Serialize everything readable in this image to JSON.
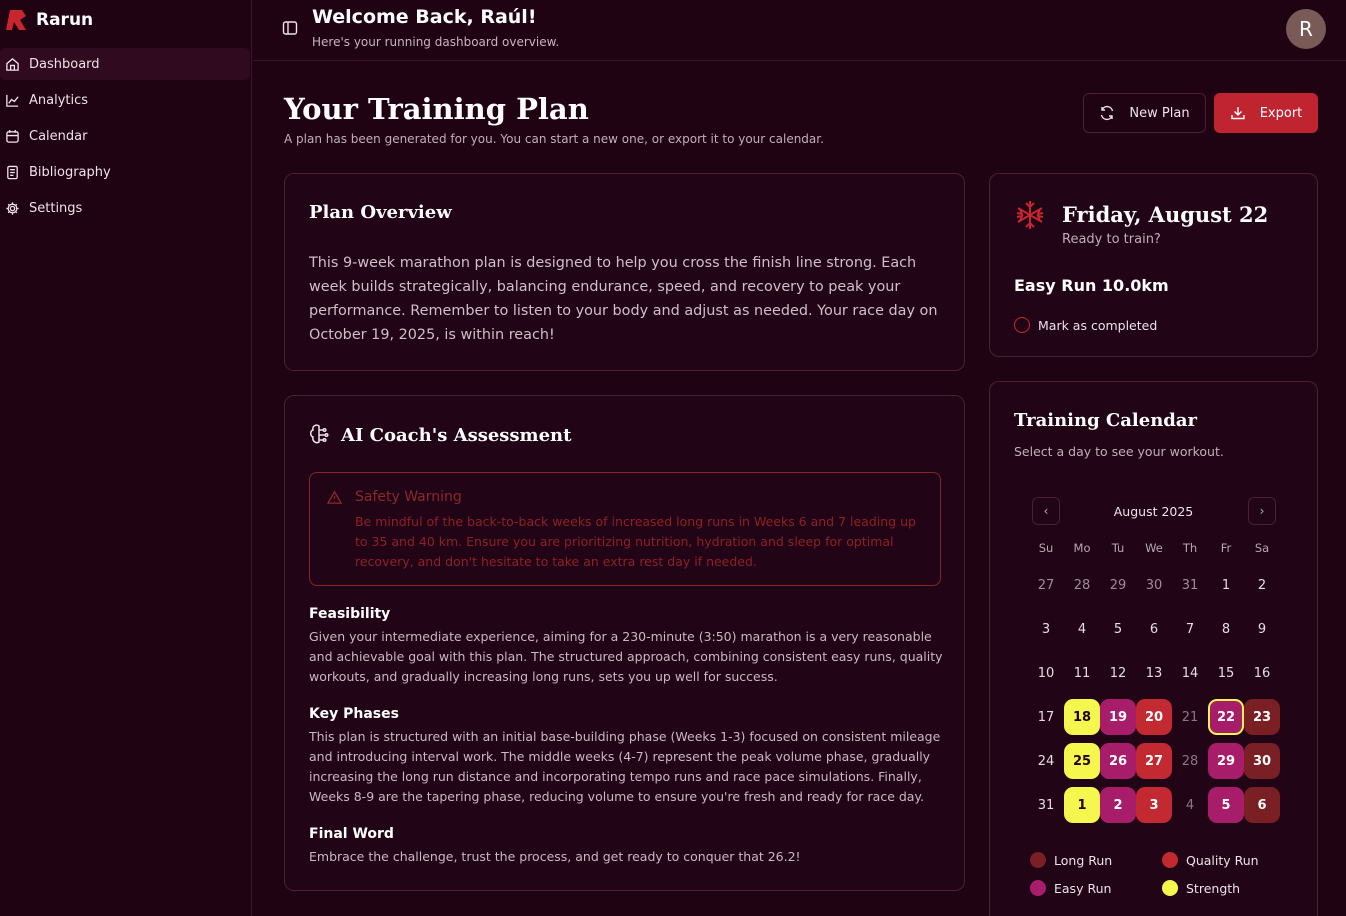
{
  "brand": {
    "name": "Rarun",
    "color": "#c7262f"
  },
  "sidebar": {
    "items": [
      {
        "label": "Dashboard",
        "icon": "home-icon",
        "active": true
      },
      {
        "label": "Analytics",
        "icon": "chart-line-icon",
        "active": false
      },
      {
        "label": "Calendar",
        "icon": "calendar-icon",
        "active": false
      },
      {
        "label": "Bibliography",
        "icon": "book-icon",
        "active": false
      },
      {
        "label": "Settings",
        "icon": "gear-icon",
        "active": false
      }
    ]
  },
  "header": {
    "title": "Welcome Back, Raúl!",
    "subtitle": "Here's your running dashboard overview.",
    "avatar_initial": "R"
  },
  "page": {
    "title": "Your Training Plan",
    "subtitle": "A plan has been generated for you. You can start a new one, or export it to your calendar.",
    "new_plan_label": "New Plan",
    "export_label": "Export"
  },
  "overview": {
    "title": "Plan Overview",
    "text": "This 9-week marathon plan is designed to help you cross the finish line strong. Each week builds strategically, balancing endurance, speed, and recovery to peak your performance. Remember to listen to your body and adjust as needed. Your race day on October 19, 2025, is within reach!"
  },
  "coach": {
    "title": "AI Coach's Assessment",
    "warning_title": "Safety Warning",
    "warning_text": "Be mindful of the back-to-back weeks of increased long runs in Weeks 6 and 7 leading up to 35 and 40 km. Ensure you are prioritizing nutrition, hydration and sleep for optimal recovery, and don't hesitate to take an extra rest day if needed.",
    "feasibility_title": "Feasibility",
    "feasibility_text": "Given your intermediate experience, aiming for a 230-minute (3:50) marathon is a very reasonable and achievable goal with this plan. The structured approach, combining consistent easy runs, quality workouts, and gradually increasing long runs, sets you up well for success.",
    "phases_title": "Key Phases",
    "phases_text": "This plan is structured with an initial base-building phase (Weeks 1-3) focused on consistent mileage and introducing interval work. The middle weeks (4-7) represent the peak volume phase, gradually increasing the long run distance and incorporating tempo runs and race pace simulations. Finally, Weeks 8-9 are the tapering phase, reducing volume to ensure you're fresh and ready for race day.",
    "final_title": "Final Word",
    "final_text": "Embrace the challenge, trust the process, and get ready to conquer that 26.2!"
  },
  "today": {
    "date": "Friday, August 22",
    "subtitle": "Ready to train?",
    "workout": "Easy Run 10.0km",
    "mark_label": "Mark as completed"
  },
  "calendar": {
    "title": "Training Calendar",
    "subtitle": "Select a day to see your workout.",
    "month": "August 2025",
    "weekdays": [
      "Su",
      "Mo",
      "Tu",
      "We",
      "Th",
      "Fr",
      "Sa"
    ],
    "days": [
      {
        "d": "27",
        "t": "muted"
      },
      {
        "d": "28",
        "t": "muted"
      },
      {
        "d": "29",
        "t": "muted"
      },
      {
        "d": "30",
        "t": "muted"
      },
      {
        "d": "31",
        "t": "muted"
      },
      {
        "d": "1",
        "t": ""
      },
      {
        "d": "2",
        "t": ""
      },
      {
        "d": "3",
        "t": ""
      },
      {
        "d": "4",
        "t": ""
      },
      {
        "d": "5",
        "t": ""
      },
      {
        "d": "6",
        "t": ""
      },
      {
        "d": "7",
        "t": ""
      },
      {
        "d": "8",
        "t": ""
      },
      {
        "d": "9",
        "t": ""
      },
      {
        "d": "10",
        "t": ""
      },
      {
        "d": "11",
        "t": ""
      },
      {
        "d": "12",
        "t": ""
      },
      {
        "d": "13",
        "t": ""
      },
      {
        "d": "14",
        "t": ""
      },
      {
        "d": "15",
        "t": ""
      },
      {
        "d": "16",
        "t": ""
      },
      {
        "d": "17",
        "t": ""
      },
      {
        "d": "18",
        "t": "strength"
      },
      {
        "d": "19",
        "t": "easy"
      },
      {
        "d": "20",
        "t": "quality"
      },
      {
        "d": "21",
        "t": "dim"
      },
      {
        "d": "22",
        "t": "easy selected"
      },
      {
        "d": "23",
        "t": "long"
      },
      {
        "d": "24",
        "t": ""
      },
      {
        "d": "25",
        "t": "strength"
      },
      {
        "d": "26",
        "t": "easy"
      },
      {
        "d": "27",
        "t": "quality"
      },
      {
        "d": "28",
        "t": "dim"
      },
      {
        "d": "29",
        "t": "easy"
      },
      {
        "d": "30",
        "t": "long"
      },
      {
        "d": "31",
        "t": ""
      },
      {
        "d": "1",
        "t": "strength"
      },
      {
        "d": "2",
        "t": "easy"
      },
      {
        "d": "3",
        "t": "quality"
      },
      {
        "d": "4",
        "t": "dim"
      },
      {
        "d": "5",
        "t": "easy"
      },
      {
        "d": "6",
        "t": "long"
      }
    ],
    "legend": [
      {
        "label": "Long Run",
        "color": "#7a1f24"
      },
      {
        "label": "Quality Run",
        "color": "#c22930"
      },
      {
        "label": "Easy Run",
        "color": "#a81d6a"
      },
      {
        "label": "Strength",
        "color": "#f5f74e"
      }
    ]
  }
}
